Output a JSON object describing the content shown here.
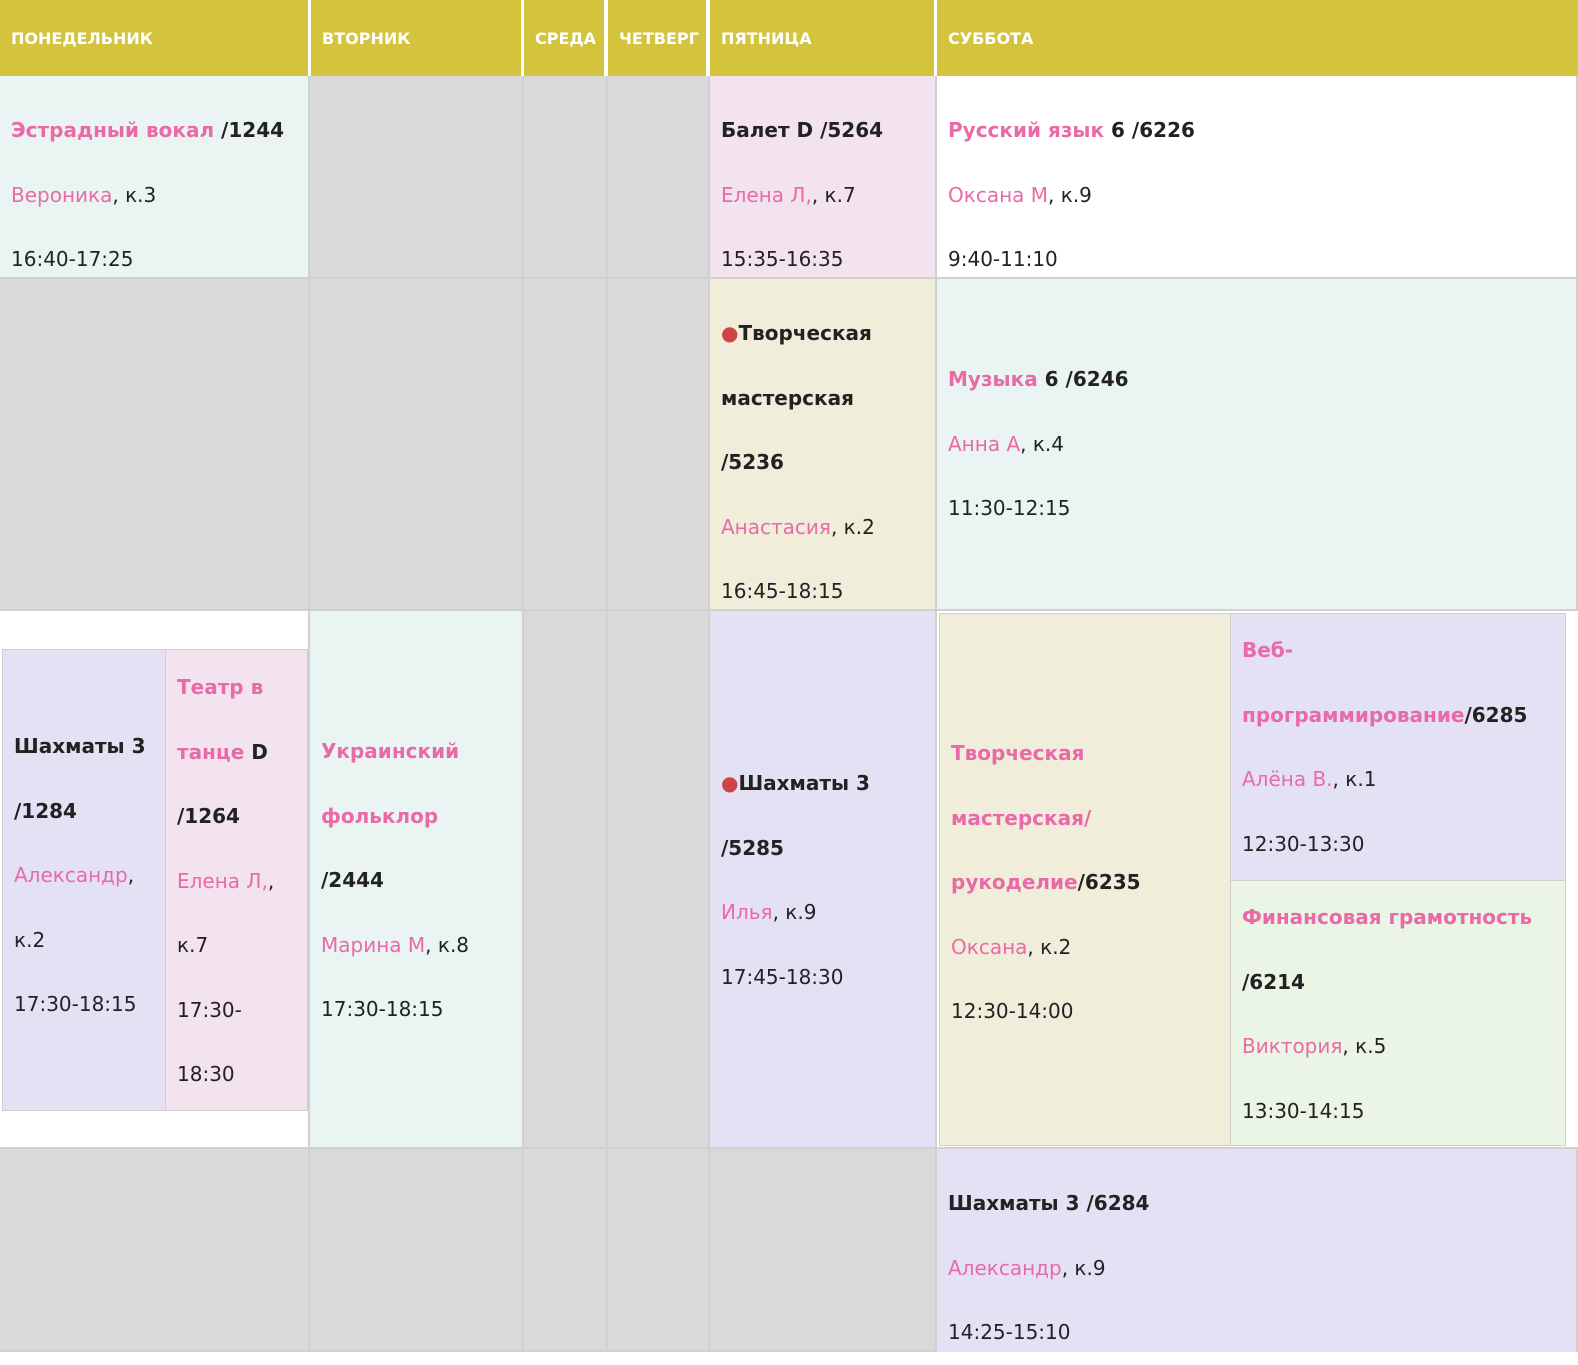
{
  "days": {
    "mon": "ПОНЕДЕЛЬНИК",
    "tue": "ВТОРНИК",
    "wed": "СРЕДА",
    "thu": "ЧЕТВЕРГ",
    "fri": "ПЯТНИЦА",
    "sat": "СУББОТА"
  },
  "lessons": {
    "mon_vocal": {
      "title": "Эстрадный вокал",
      "code": " /1244",
      "teacher": "Вероника",
      "room": ", к.3",
      "time": "16:40-17:25"
    },
    "fri_ballet": {
      "title": "Балет D /5264",
      "teacher": "Елена Л,",
      "room": ", к.7",
      "time": "15:35-16:35"
    },
    "sat_russian": {
      "title": "Русский язык",
      "code": " 6 /6226",
      "teacher": "Оксана М",
      "room": ", к.9",
      "time": "9:40-11:10"
    },
    "fri_workshop": {
      "bullet": "●",
      "title_a": "Творческая",
      "title_b": "мастерская",
      "code": "/5236",
      "teacher": "Анастасия",
      "room": ", к.2",
      "time": "16:45-18:15"
    },
    "sat_music": {
      "title": "Музыка",
      "code": " 6 /6246",
      "teacher": "Анна А",
      "room": ", к.4",
      "time": "11:30-12:15"
    },
    "mon_chess": {
      "title": "Шахматы 3",
      "code": "/1284",
      "teacher": "Александр",
      "room_a": ",",
      "room_b": "к.2",
      "time": "17:30-18:15"
    },
    "mon_theatre": {
      "title_a": "Театр в",
      "title_b": "танце",
      "title_c": " D",
      "code": "/1264",
      "teacher": "Елена Л,",
      "room_a": ",",
      "room_b": "к.7",
      "time_a": "17:30-",
      "time_b": "18:30"
    },
    "tue_folk": {
      "title_a": "Украинский",
      "title_b": "фольклор",
      "code": "/2444",
      "teacher": "Марина М",
      "room": ", к.8",
      "time": "17:30-18:15"
    },
    "fri_chess": {
      "bullet": "●",
      "title": "Шахматы 3",
      "code": "/5285",
      "teacher": "Илья",
      "room": ", к.9",
      "time": "17:45-18:30"
    },
    "sat_crafts": {
      "title_a": "Творческая",
      "title_b": "мастерская/",
      "title_c": "рукоделие",
      "code": "/6235",
      "teacher": "Оксана",
      "room": ", к.2",
      "time": "12:30-14:00"
    },
    "sat_web": {
      "title_a": "Веб-",
      "title_b": "программирование",
      "code": "/6285",
      "teacher": "Алёна В.",
      "room": ", к.1",
      "time": "12:30-13:30"
    },
    "sat_finance": {
      "title": "Финансовая грамотность",
      "code": "/6214",
      "teacher": "Виктория",
      "room": ", к.5",
      "time": "13:30-14:15"
    },
    "sat_chess": {
      "title": "Шахматы 3 /6284",
      "teacher": "Александр",
      "room": ", к.9",
      "time": "14:25-15:10"
    }
  },
  "colors": {
    "header": "#d4c43d",
    "accent_pink": "#e96aa6",
    "empty": "#d9d9d9"
  }
}
